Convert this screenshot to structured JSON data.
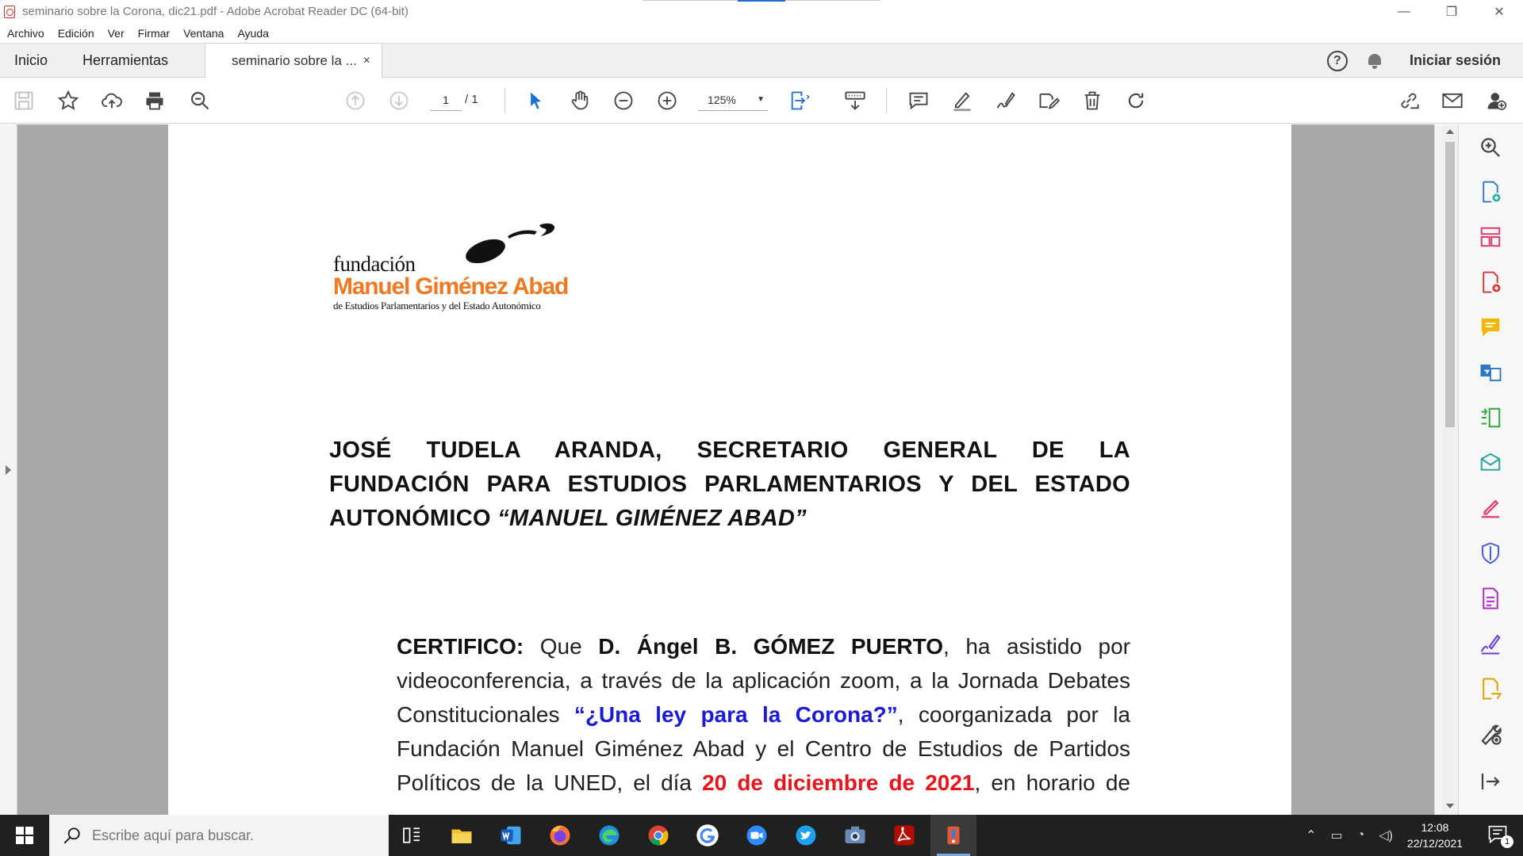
{
  "window": {
    "title": "seminario sobre la Corona, dic21.pdf - Adobe Acrobat Reader DC (64-bit)",
    "controls": {
      "minimize": "—",
      "restore": "❐",
      "close": "✕"
    }
  },
  "menu": [
    "Archivo",
    "Edición",
    "Ver",
    "Firmar",
    "Ventana",
    "Ayuda"
  ],
  "tabs": {
    "home": "Inicio",
    "tools": "Herramientas",
    "document": "seminario sobre la ...",
    "close": "×",
    "help": "?",
    "signin": "Iniciar sesión"
  },
  "toolbar": {
    "page_current": "1",
    "page_total": "/ 1",
    "zoom": "125%",
    "icons": [
      "save-icon",
      "bookmark-star-icon",
      "upload-cloud-icon",
      "print-icon",
      "search-zoom-icon",
      "prev-page-icon",
      "next-page-icon",
      "select-cursor-icon",
      "hand-tool-icon",
      "zoom-out-icon",
      "zoom-in-icon",
      "fit-page-icon",
      "scroll-mode-icon",
      "comment-icon",
      "highlight-pen-icon",
      "sign-icon",
      "edit-fill-icon",
      "delete-icon",
      "rotate-icon",
      "share-link-icon",
      "email-icon",
      "add-user-icon"
    ]
  },
  "document": {
    "logo": {
      "line1": "fundación",
      "line2": "Manuel Giménez Abad",
      "line3": "de Estudios Parlamentarios y del Estado Autonómico"
    },
    "heading": {
      "line1": "JOSÉ TUDELA ARANDA, SECRETARIO GENERAL DE LA",
      "line2": "FUNDACIÓN PARA ESTUDIOS PARLAMENTARIOS Y DEL ESTADO",
      "line3a": "AUTONÓMICO ",
      "line3b": "“MANUEL GIMÉNEZ ABAD”"
    },
    "body": {
      "certifico": "CERTIFICO:",
      "que": " Que ",
      "name": "D. Ángel B. GÓMEZ PUERTO",
      "l1rest": ", ha asistido por",
      "l2": "videoconferencia, a través de la aplicación zoom, a la Jornada Debates",
      "l3a": "Constitucionales ",
      "l3b": "“¿Una ley para la Corona?”",
      "l3c": ", coorganizada por la",
      "l4": "Fundación Manuel Giménez Abad y el Centro de Estudios de Partidos",
      "l5a": "Políticos de la UNED, el día ",
      "l5b": "20 de diciembre de 2021",
      "l5c": ", en horario de"
    },
    "colors": {
      "logo_orange": "#f07820",
      "highlight_blue": "#1b1bd6",
      "highlight_red": "#e8131b"
    }
  },
  "right_tools": [
    "zoom-magnifier-icon",
    "export-pdf-icon",
    "organize-pages-icon",
    "create-pdf-icon",
    "comment-tool-icon",
    "combine-files-icon",
    "compress-pdf-icon",
    "send-review-icon",
    "fill-sign-icon",
    "protect-icon",
    "form-icon",
    "request-signature-icon",
    "send-track-icon",
    "more-tools-icon",
    "collapse-panel-icon"
  ],
  "taskbar": {
    "search_placeholder": "Escribe aquí para buscar.",
    "apps": [
      "task-view-icon",
      "file-explorer-icon",
      "word-icon",
      "firefox-icon",
      "edge-icon",
      "chrome-icon",
      "google-icon",
      "zoom-icon",
      "twitter-icon",
      "camera-icon",
      "acrobat-icon",
      "app-active-icon"
    ],
    "time": "12:08",
    "date": "22/12/2021",
    "notification_count": "1"
  }
}
